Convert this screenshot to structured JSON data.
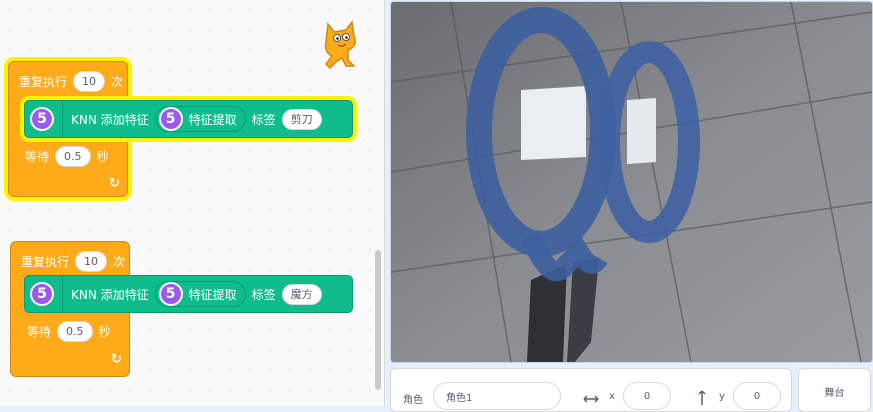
{
  "stack1": {
    "repeat_label": "重复执行",
    "repeat_count": "10",
    "repeat_unit": "次",
    "ext_icon": "5",
    "knn_label": "KNN 添加特征",
    "reporter_icon": "5",
    "feature_label": "特征提取",
    "tag_label": "标签",
    "tag_value": "剪刀",
    "wait_label": "等待",
    "wait_value": "0.5",
    "wait_unit": "秒",
    "loop_arrow": "↻"
  },
  "stack2": {
    "repeat_label": "重复执行",
    "repeat_count": "10",
    "repeat_unit": "次",
    "ext_icon": "5",
    "knn_label": "KNN 添加特征",
    "reporter_icon": "5",
    "feature_label": "特征提取",
    "tag_label": "标签",
    "tag_value": "魔方",
    "wait_label": "等待",
    "wait_value": "0.5",
    "wait_unit": "秒",
    "loop_arrow": "↻"
  },
  "sprite_info": {
    "sprite_label": "角色",
    "sprite_name": "角色1",
    "x_label": "x",
    "x_value": "0",
    "y_label": "y",
    "y_value": "0"
  },
  "stage_panel": {
    "label": "舞台"
  },
  "colors": {
    "control": "#ffab19",
    "extension": "#0fbd8c",
    "ext_icon": "#9b59f4",
    "highlight": "#fff200"
  },
  "icons": [
    "scratch-cat-icon",
    "loop-arrow-icon",
    "horizontal-arrows-icon",
    "vertical-arrows-icon"
  ]
}
